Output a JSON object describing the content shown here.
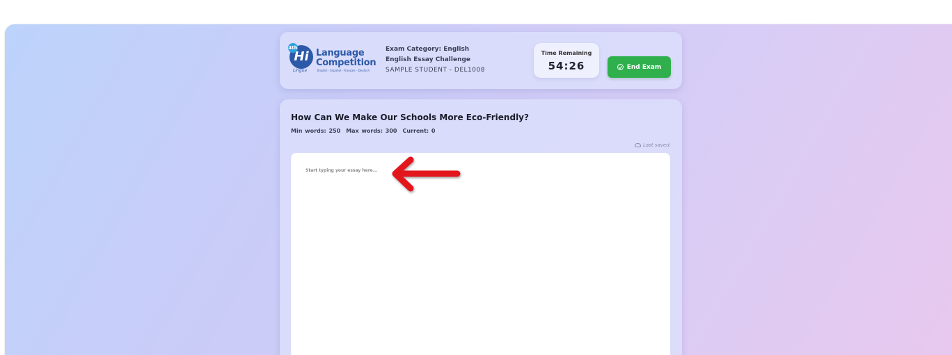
{
  "header": {
    "logo": {
      "badge_text": "Hi",
      "badge_superscript": "4th",
      "badge_subtext": "Lingua",
      "line1": "Language",
      "line2": "Competition",
      "tagline": "English - Español - Français - Deutsch"
    },
    "exam_category": "Exam Category: English",
    "exam_name": "English Essay Challenge",
    "student": "SAMPLE STUDENT - DEL1008",
    "timer": {
      "label": "Time Remaining",
      "value": "54:26"
    },
    "end_exam_label": "End Exam"
  },
  "essay": {
    "title": "How Can We Make Our Schools More Eco-Friendly?",
    "min_words": "Min words: 250",
    "max_words": "Max words: 300",
    "current_words": "Current: 0",
    "last_saved": "Last saved:",
    "placeholder": "Start typing your essay here..."
  },
  "colors": {
    "end_exam_button": "#2fb04d",
    "annotation_arrow": "#e3121e",
    "brand_blue": "#2c5aa8"
  }
}
